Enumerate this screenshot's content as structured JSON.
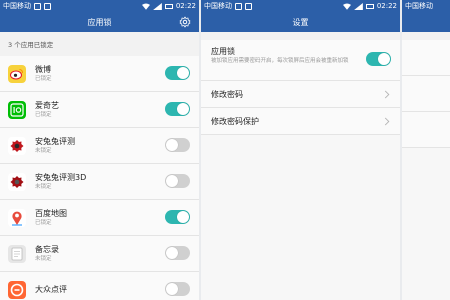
{
  "status": {
    "carrier": "中国移动",
    "time": "02:22"
  },
  "applock": {
    "title": "应用锁",
    "count_text": "3 个应用已锁定",
    "apps": [
      {
        "name": "微博",
        "status": "已锁定",
        "on": true,
        "color": "#f7d23c",
        "icon": "weibo-icon"
      },
      {
        "name": "爱奇艺",
        "status": "已锁定",
        "on": true,
        "color": "#00be06",
        "icon": "iqiyi-icon"
      },
      {
        "name": "安兔兔评测",
        "status": "未锁定",
        "on": false,
        "color": "#ffffff",
        "icon": "antutu-icon"
      },
      {
        "name": "安兔兔评测3D",
        "status": "未锁定",
        "on": false,
        "color": "#ffffff",
        "icon": "antutu3d-icon"
      },
      {
        "name": "百度地图",
        "status": "已锁定",
        "on": true,
        "color": "#ffffff",
        "icon": "baidu-map-icon"
      },
      {
        "name": "备忘录",
        "status": "未锁定",
        "on": false,
        "color": "#e6e6e6",
        "icon": "memo-icon"
      },
      {
        "name": "大众点评",
        "status": "",
        "on": false,
        "color": "#ff6633",
        "icon": "dianping-icon"
      }
    ]
  },
  "settings": {
    "title": "设置",
    "applock_label": "应用锁",
    "applock_desc": "被加锁应用需要密码开启，每次锁屏后应用会被重新加锁",
    "applock_on": true,
    "change_password": "修改密码",
    "change_password_protect": "修改密码保护"
  },
  "colors": {
    "accent": "#2c5fa8",
    "toggle_on": "#2db6b0",
    "toggle_off": "#d0d0d0"
  }
}
